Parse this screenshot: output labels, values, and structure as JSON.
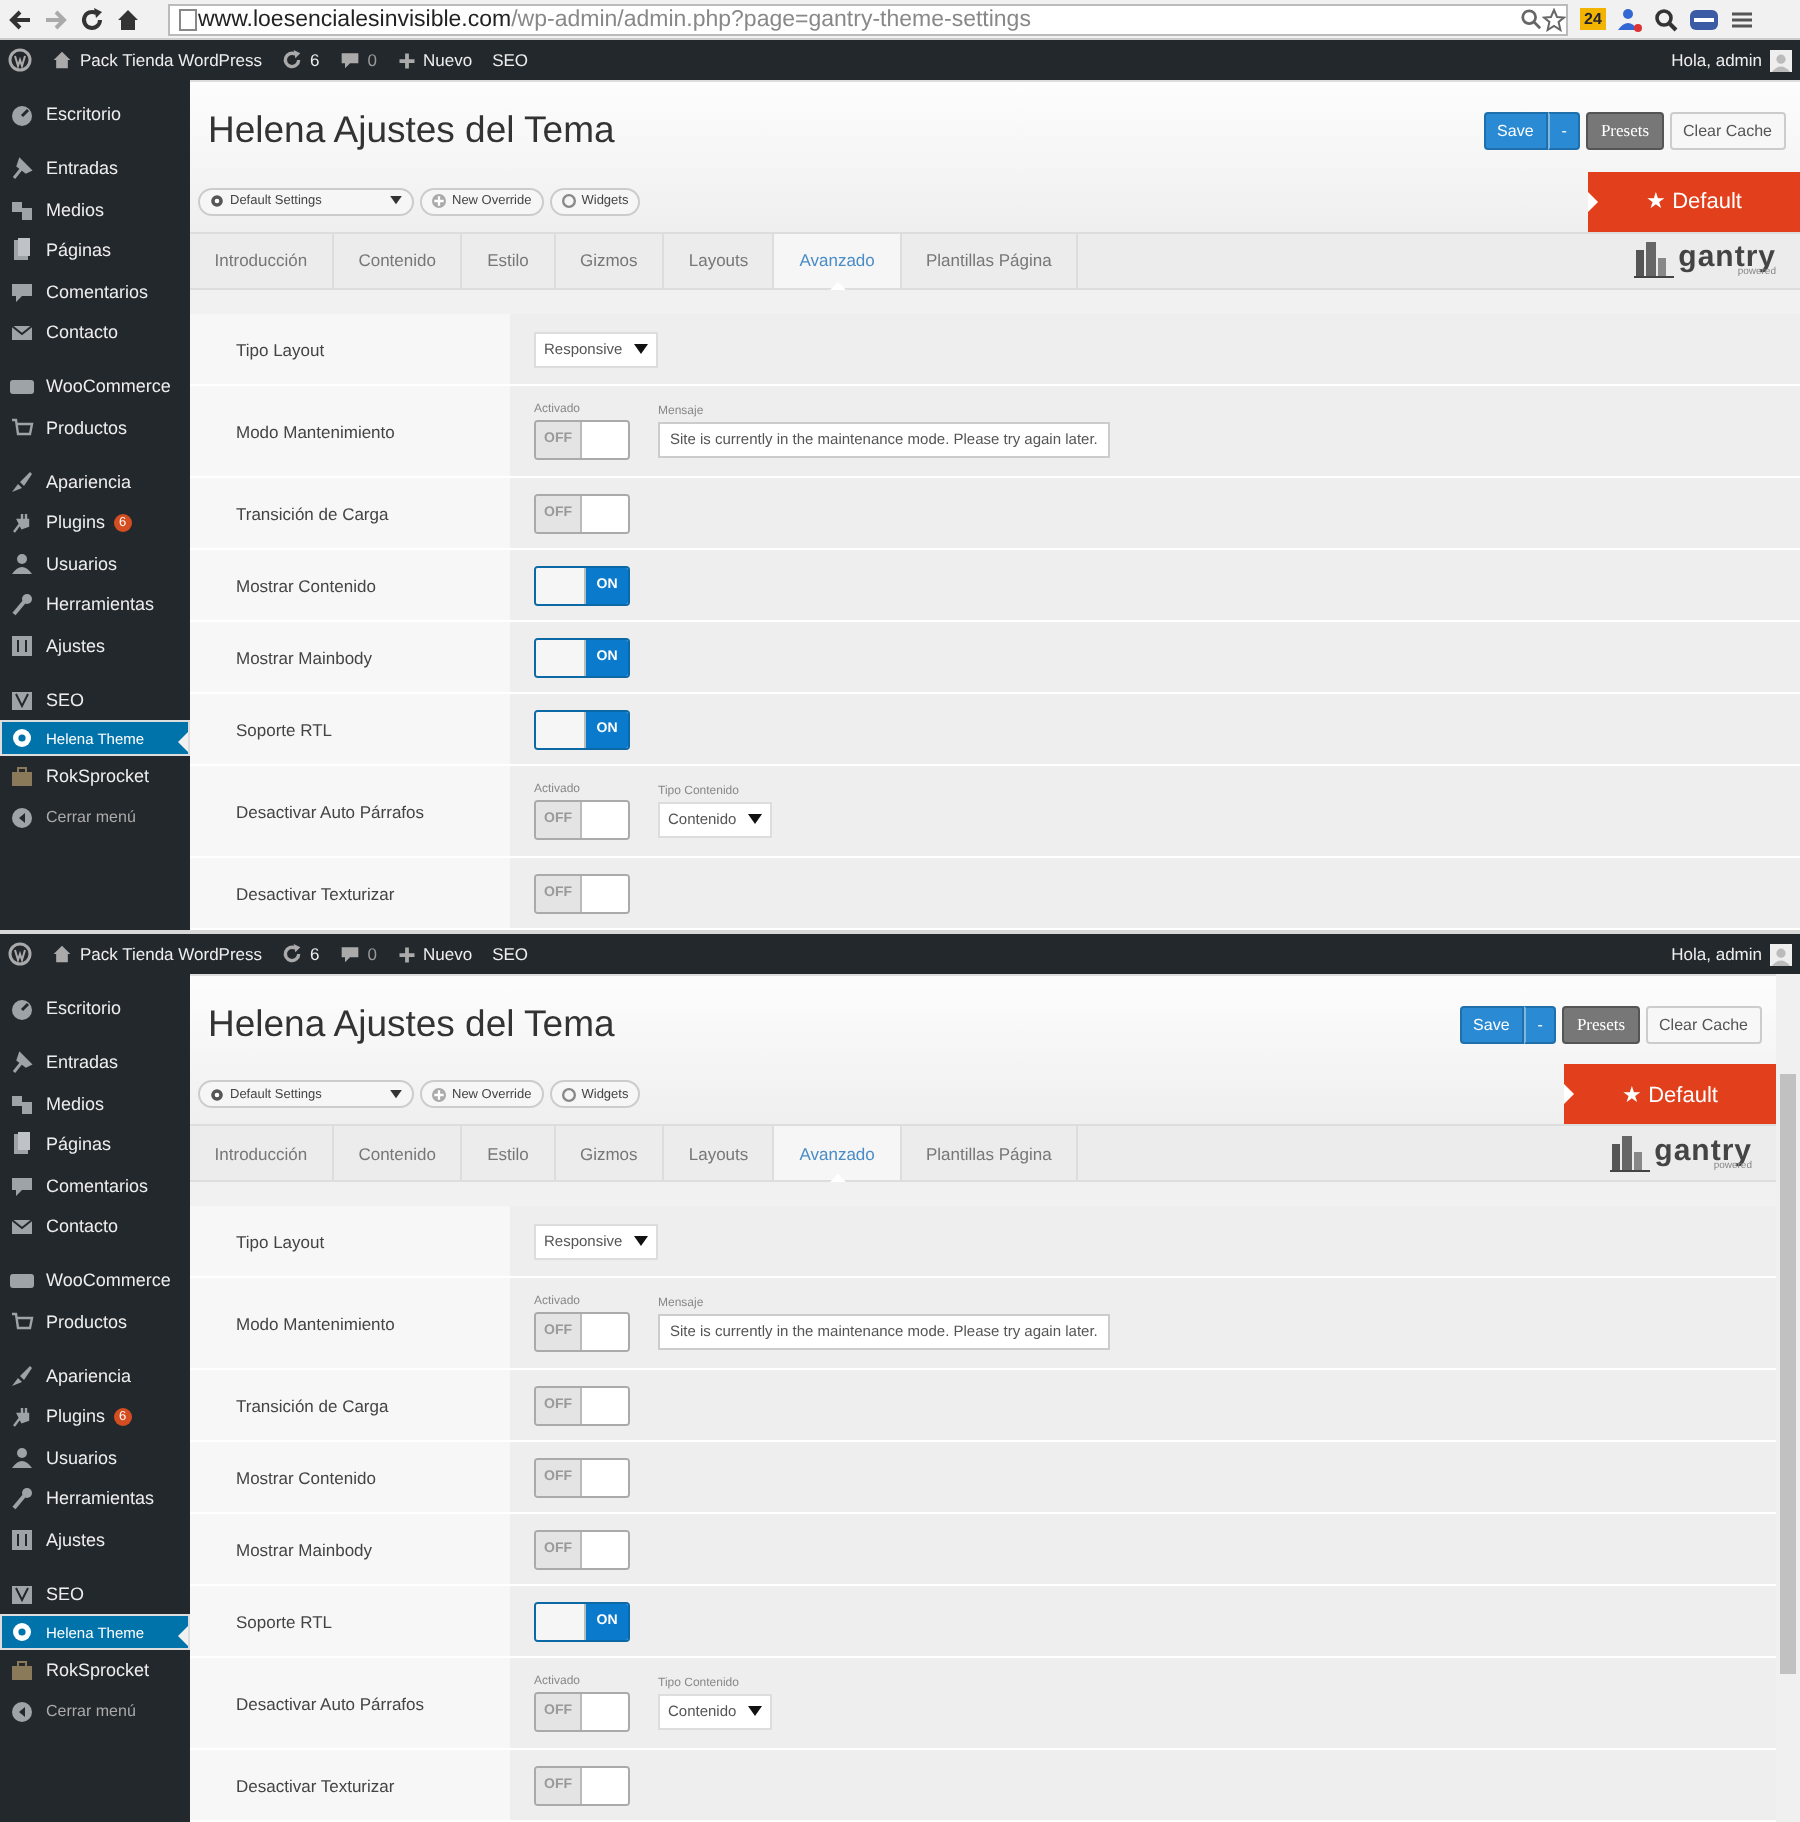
{
  "browser": {
    "url": {
      "host": "www.loesencialesinvisible.com",
      "path": "/wp-admin/admin.php?page=gantry-theme-settings"
    },
    "badge": "24"
  },
  "screens": [
    {
      "scrollbar": false,
      "admin_bar": {
        "site": "Pack Tienda WordPress",
        "updates": "6",
        "comments": "0",
        "new": "Nuevo",
        "seo": "SEO",
        "greeting": "Hola, admin"
      },
      "sidebar": {
        "groups": [
          {
            "items": [
              {
                "label": "Escritorio",
                "selected": false
              }
            ]
          },
          {
            "items": [
              {
                "label": "Entradas",
                "selected": false
              },
              {
                "label": "Medios",
                "selected": false
              },
              {
                "label": "Páginas",
                "selected": false
              },
              {
                "label": "Comentarios",
                "selected": false
              },
              {
                "label": "Contacto",
                "selected": false
              }
            ]
          },
          {
            "items": [
              {
                "label": "WooCommerce",
                "selected": false
              },
              {
                "label": "Productos",
                "selected": false
              }
            ]
          },
          {
            "items": [
              {
                "label": "Apariencia",
                "selected": false
              },
              {
                "label": "Plugins",
                "badge": "6",
                "selected": false
              },
              {
                "label": "Usuarios",
                "selected": false
              },
              {
                "label": "Herramientas",
                "selected": false
              },
              {
                "label": "Ajustes",
                "selected": false
              }
            ]
          },
          {
            "items": [
              {
                "label": "SEO",
                "selected": false
              },
              {
                "label": "Helena Theme",
                "selected": true
              },
              {
                "label": "RokSprocket",
                "selected": false
              },
              {
                "label": "Cerrar menú",
                "selected": false
              }
            ]
          }
        ]
      },
      "header": {
        "title": "Helena Ajustes del Tema",
        "save": "Save",
        "save_caret": "-",
        "presets": "Presets",
        "clear_cache": "Clear Cache",
        "settings_select": "Default Settings",
        "new_override": "New Override",
        "widgets": "Widgets",
        "default_banner": "★ Default",
        "logo": "gantry",
        "logo_sub": "powered"
      },
      "tabs": [
        {
          "label": "Introducción",
          "selected": false
        },
        {
          "label": "Contenido",
          "selected": false
        },
        {
          "label": "Estilo",
          "selected": false
        },
        {
          "label": "Gizmos",
          "selected": false
        },
        {
          "label": "Layouts",
          "selected": false
        },
        {
          "label": "Avanzado",
          "selected": true
        },
        {
          "label": "Plantillas Página",
          "selected": false
        }
      ],
      "rows": [
        {
          "label": "Tipo Layout",
          "controls": [
            {
              "kind": "select",
              "value": "Responsive"
            }
          ]
        },
        {
          "label": "Modo Mantenimiento",
          "controls": [
            {
              "kind": "toggle",
              "caption": "Activado",
              "on": false,
              "text": "OFF"
            },
            {
              "kind": "text",
              "caption": "Mensaje",
              "value": "Site is currently in the maintenance mode. Please try again later."
            }
          ]
        },
        {
          "label": "Transición de Carga",
          "controls": [
            {
              "kind": "toggle",
              "on": false,
              "text": "OFF"
            }
          ]
        },
        {
          "label": "Mostrar Contenido",
          "controls": [
            {
              "kind": "toggle",
              "on": true,
              "text": "ON"
            }
          ]
        },
        {
          "label": "Mostrar Mainbody",
          "controls": [
            {
              "kind": "toggle",
              "on": true,
              "text": "ON"
            }
          ]
        },
        {
          "label": "Soporte RTL",
          "controls": [
            {
              "kind": "toggle",
              "on": true,
              "text": "ON"
            }
          ]
        },
        {
          "label": "Desactivar Auto Párrafos",
          "controls": [
            {
              "kind": "toggle",
              "caption": "Activado",
              "on": false,
              "text": "OFF"
            },
            {
              "kind": "select",
              "caption": "Tipo Contenido",
              "value": "Contenido"
            }
          ]
        },
        {
          "label": "Desactivar Texturizar",
          "controls": [
            {
              "kind": "toggle",
              "on": false,
              "text": "OFF"
            }
          ]
        }
      ]
    },
    {
      "scrollbar": true,
      "admin_bar": {
        "site": "Pack Tienda WordPress",
        "updates": "6",
        "comments": "0",
        "new": "Nuevo",
        "seo": "SEO",
        "greeting": "Hola, admin"
      },
      "sidebar": {
        "groups": [
          {
            "items": [
              {
                "label": "Escritorio",
                "selected": false
              }
            ]
          },
          {
            "items": [
              {
                "label": "Entradas",
                "selected": false
              },
              {
                "label": "Medios",
                "selected": false
              },
              {
                "label": "Páginas",
                "selected": false
              },
              {
                "label": "Comentarios",
                "selected": false
              },
              {
                "label": "Contacto",
                "selected": false
              }
            ]
          },
          {
            "items": [
              {
                "label": "WooCommerce",
                "selected": false
              },
              {
                "label": "Productos",
                "selected": false
              }
            ]
          },
          {
            "items": [
              {
                "label": "Apariencia",
                "selected": false
              },
              {
                "label": "Plugins",
                "badge": "6",
                "selected": false
              },
              {
                "label": "Usuarios",
                "selected": false
              },
              {
                "label": "Herramientas",
                "selected": false
              },
              {
                "label": "Ajustes",
                "selected": false
              }
            ]
          },
          {
            "items": [
              {
                "label": "SEO",
                "selected": false
              },
              {
                "label": "Helena Theme",
                "selected": true
              },
              {
                "label": "RokSprocket",
                "selected": false
              },
              {
                "label": "Cerrar menú",
                "selected": false
              }
            ]
          }
        ]
      },
      "header": {
        "title": "Helena Ajustes del Tema",
        "save": "Save",
        "save_caret": "-",
        "presets": "Presets",
        "clear_cache": "Clear Cache",
        "settings_select": "Default Settings",
        "new_override": "New Override",
        "widgets": "Widgets",
        "default_banner": "★ Default",
        "logo": "gantry",
        "logo_sub": "powered"
      },
      "tabs": [
        {
          "label": "Introducción",
          "selected": false
        },
        {
          "label": "Contenido",
          "selected": false
        },
        {
          "label": "Estilo",
          "selected": false
        },
        {
          "label": "Gizmos",
          "selected": false
        },
        {
          "label": "Layouts",
          "selected": false
        },
        {
          "label": "Avanzado",
          "selected": true
        },
        {
          "label": "Plantillas Página",
          "selected": false
        }
      ],
      "rows": [
        {
          "label": "Tipo Layout",
          "controls": [
            {
              "kind": "select",
              "value": "Responsive"
            }
          ]
        },
        {
          "label": "Modo Mantenimiento",
          "controls": [
            {
              "kind": "toggle",
              "caption": "Activado",
              "on": false,
              "text": "OFF"
            },
            {
              "kind": "text",
              "caption": "Mensaje",
              "value": "Site is currently in the maintenance mode. Please try again later."
            }
          ]
        },
        {
          "label": "Transición de Carga",
          "controls": [
            {
              "kind": "toggle",
              "on": false,
              "text": "OFF"
            }
          ]
        },
        {
          "label": "Mostrar Contenido",
          "controls": [
            {
              "kind": "toggle",
              "on": false,
              "text": "OFF"
            }
          ]
        },
        {
          "label": "Mostrar Mainbody",
          "controls": [
            {
              "kind": "toggle",
              "on": false,
              "text": "OFF"
            }
          ]
        },
        {
          "label": "Soporte RTL",
          "controls": [
            {
              "kind": "toggle",
              "on": true,
              "text": "ON"
            }
          ]
        },
        {
          "label": "Desactivar Auto Párrafos",
          "controls": [
            {
              "kind": "toggle",
              "caption": "Activado",
              "on": false,
              "text": "OFF"
            },
            {
              "kind": "select",
              "caption": "Tipo Contenido",
              "value": "Contenido"
            }
          ]
        },
        {
          "label": "Desactivar Texturizar",
          "controls": [
            {
              "kind": "toggle",
              "on": false,
              "text": "OFF"
            }
          ]
        }
      ]
    }
  ]
}
